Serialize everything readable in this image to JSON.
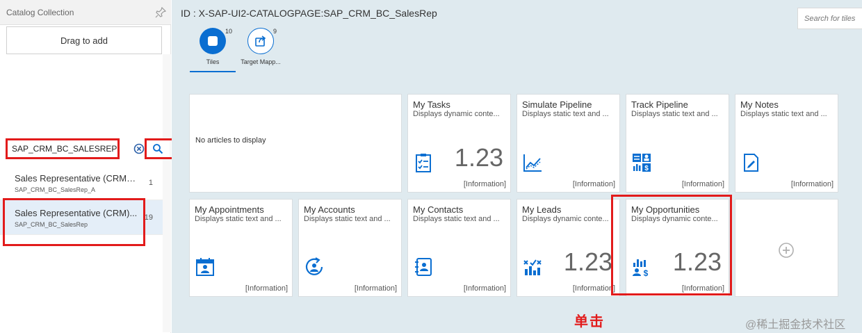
{
  "left_pane": {
    "title": "Catalog Collection",
    "drag_label": "Drag to add",
    "search_value": "SAP_CRM_BC_SALESREP",
    "items": [
      {
        "title": "Sales Representative (CRM) ...",
        "id": "SAP_CRM_BC_SalesRep_A",
        "count": "1",
        "selected": false
      },
      {
        "title": "Sales Representative (CRM)...",
        "id": "SAP_CRM_BC_SalesRep",
        "count": "19",
        "selected": true
      }
    ]
  },
  "main": {
    "page_id": "ID : X-SAP-UI2-CATALOGPAGE:SAP_CRM_BC_SalesRep",
    "search_placeholder": "Search for tiles",
    "tabs": [
      {
        "label": "Tiles",
        "count": "10",
        "active": true
      },
      {
        "label": "Target Mapp...",
        "count": "9",
        "active": false
      }
    ],
    "news_tile_text": "No articles to display",
    "tiles": [
      {
        "title": "My Tasks",
        "subtitle": "Displays dynamic conte...",
        "number": "1.23",
        "footer": "[Information]",
        "icon": "task-list-icon"
      },
      {
        "title": "Simulate Pipeline",
        "subtitle": "Displays static text and ...",
        "number": "",
        "footer": "[Information]",
        "icon": "line-chart-icon"
      },
      {
        "title": "Track Pipeline",
        "subtitle": "Displays static text and ...",
        "number": "",
        "footer": "[Information]",
        "icon": "pipeline-dashboard-icon"
      },
      {
        "title": "My Notes",
        "subtitle": "Displays static text and ...",
        "number": "",
        "footer": "[Information]",
        "icon": "notes-icon"
      },
      {
        "title": "My Appointments",
        "subtitle": "Displays static text and ...",
        "number": "",
        "footer": "[Information]",
        "icon": "calendar-person-icon"
      },
      {
        "title": "My Accounts",
        "subtitle": "Displays static text and ...",
        "number": "",
        "footer": "[Information]",
        "icon": "account-refresh-icon"
      },
      {
        "title": "My Contacts",
        "subtitle": "Displays static text and ...",
        "number": "",
        "footer": "[Information]",
        "icon": "address-book-icon"
      },
      {
        "title": "My Leads",
        "subtitle": "Displays dynamic conte...",
        "number": "1.23",
        "footer": "[Information]",
        "icon": "leads-chart-icon"
      },
      {
        "title": "My Opportunities",
        "subtitle": "Displays dynamic conte...",
        "number": "1.23",
        "footer": "[Information]",
        "icon": "opportunity-chart-icon"
      }
    ]
  },
  "annotation": {
    "click_label": "单击",
    "watermark": "@稀土掘金技术社区"
  },
  "colors": {
    "accent": "#0a6ed1",
    "highlight": "#e21b1b",
    "main_bg": "#dfeaef"
  }
}
